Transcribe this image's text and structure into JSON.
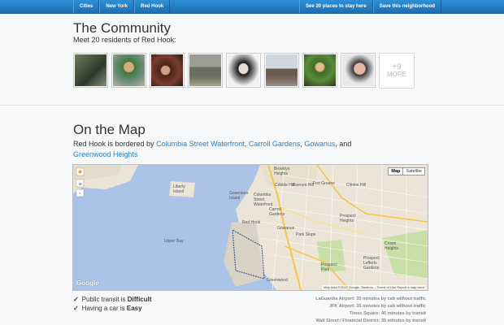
{
  "topbar": {
    "nav": [
      "Cities",
      "New York",
      "Red Hook"
    ],
    "places_label": "See 20 places to stay here",
    "save_label": "Save this neighborhood"
  },
  "community": {
    "title": "The Community",
    "subtitle": "Meet 20 residents of Red Hook:",
    "more_count": "+9",
    "more_label": "MORE"
  },
  "map_section": {
    "title": "On the Map",
    "bordered_prefix": "Red Hook is bordered by",
    "neighbors": [
      "Columbia Street Waterfront",
      "Carroll Gardens",
      "Gowanus",
      "Greenwood Heights"
    ],
    "map_type_buttons": [
      "Map",
      "Satellite"
    ],
    "map_labels": [
      "Brooklyn Heights",
      "Governors Island",
      "Columbia Street Waterfront",
      "Cobble Hill",
      "Boerum Hill",
      "Fort Greene",
      "Clinton Hill",
      "Liberty Island",
      "Carroll Gardens",
      "Red Hook",
      "Gowanus",
      "Park Slope",
      "Prospect Heights",
      "Crown Heights",
      "Prospect Park",
      "Prospect Lefferts Gardens",
      "Upper Bay",
      "Greenwood",
      "Google"
    ],
    "attribution": "Map data ©2012 Google, Sanborn – Terms of Use",
    "report": "Report a map error"
  },
  "transit": [
    {
      "prefix": "Public transit is",
      "value": "Difficult"
    },
    {
      "prefix": "Having a car is",
      "value": "Easy"
    }
  ],
  "commute": [
    "LaGuardia Airport: 35 minutes by cab without traffic",
    "JFK Airport: 35 minutes by cab without traffic",
    "Times Square: 45 minutes by transit",
    "Wall Street / Financial District: 35 minutes by transit"
  ],
  "colors": {
    "topbar": "#1f7cc6",
    "link": "#2b82c4",
    "water": "#aac3e6",
    "land": "#ece5d7",
    "park": "#c9dfa8"
  }
}
